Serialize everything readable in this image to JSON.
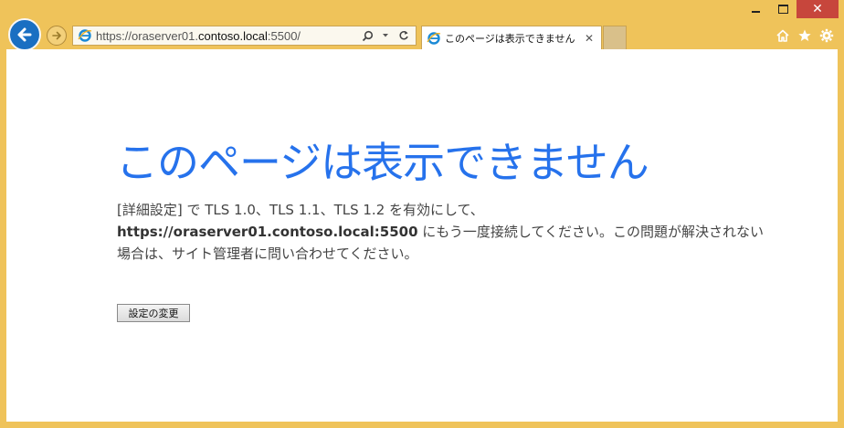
{
  "window": {
    "minimize_label": "",
    "maximize_label": "",
    "close_label": "✕"
  },
  "address": {
    "url_prefix": "https://oraserver01.",
    "url_domain": "contoso.local",
    "url_suffix": ":5500/"
  },
  "tab": {
    "title": "このページは表示できません",
    "close_label": "✕"
  },
  "error_page": {
    "title": "このページは表示できません",
    "body_intro": "[詳細設定] で TLS 1.0、TLS 1.1、TLS 1.2 を有効にして、",
    "body_url": "https://oraserver01.contoso.local:5500",
    "body_rest": " にもう一度接続してください。この問題が解決されない場合は、サイト管理者に問い合わせてください。",
    "settings_button": "設定の変更"
  },
  "icons": {
    "back": "back-arrow-icon",
    "forward": "forward-arrow-icon",
    "browser": "ie-logo-icon",
    "search": "search-icon",
    "dropdown": "dropdown-icon",
    "refresh": "refresh-icon",
    "home": "home-icon",
    "favorites": "star-icon",
    "settings": "gear-icon"
  },
  "colors": {
    "frame": "#efc35a",
    "title": "#2672ec",
    "back_button": "#1a6fc2",
    "close_button": "#c7463c"
  }
}
